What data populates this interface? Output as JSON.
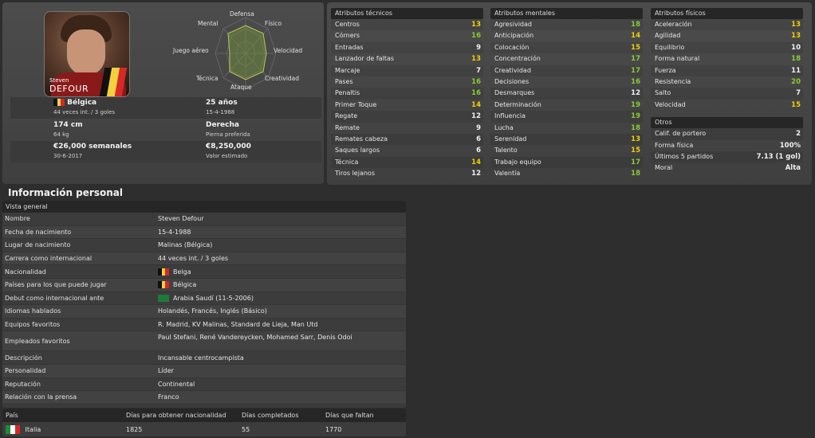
{
  "player": {
    "first_name": "Steven",
    "last_name": "DEFOUR",
    "nation": "Bélgica",
    "caps": "44 veces int. / 3 goles",
    "age": "25 años",
    "dob": "15-4-1988",
    "height": "174 cm",
    "weight": "64 kg",
    "foot": "Derecha",
    "foot_label": "Pierna preferida",
    "wage": "€26,000 semanales",
    "contract_end": "30-6-2017",
    "value": "€8,250,000",
    "value_label": "Valor estimado"
  },
  "radar": {
    "labels": [
      "Defensa",
      "Físico",
      "Velocidad",
      "Creatividad",
      "Ataque",
      "Técnica",
      "Juego aéreo",
      "Mental"
    ]
  },
  "technical": {
    "title": "Atributos técnicos",
    "items": [
      {
        "name": "Centros",
        "value": "13"
      },
      {
        "name": "Córners",
        "value": "16"
      },
      {
        "name": "Entradas",
        "value": "9"
      },
      {
        "name": "Lanzador de faltas",
        "value": "13"
      },
      {
        "name": "Marcaje",
        "value": "7"
      },
      {
        "name": "Pases",
        "value": "16"
      },
      {
        "name": "Penaltis",
        "value": "16"
      },
      {
        "name": "Primer Toque",
        "value": "14"
      },
      {
        "name": "Regate",
        "value": "12"
      },
      {
        "name": "Remate",
        "value": "9"
      },
      {
        "name": "Remates cabeza",
        "value": "6"
      },
      {
        "name": "Saques largos",
        "value": "6"
      },
      {
        "name": "Técnica",
        "value": "14"
      },
      {
        "name": "Tiros lejanos",
        "value": "12"
      }
    ]
  },
  "mental": {
    "title": "Atributos mentales",
    "items": [
      {
        "name": "Agresividad",
        "value": "18"
      },
      {
        "name": "Anticipación",
        "value": "14"
      },
      {
        "name": "Colocación",
        "value": "15"
      },
      {
        "name": "Concentración",
        "value": "17"
      },
      {
        "name": "Creatividad",
        "value": "17"
      },
      {
        "name": "Decisiones",
        "value": "16"
      },
      {
        "name": "Desmarques",
        "value": "12"
      },
      {
        "name": "Determinación",
        "value": "19"
      },
      {
        "name": "Influencia",
        "value": "19"
      },
      {
        "name": "Lucha",
        "value": "18"
      },
      {
        "name": "Serenidad",
        "value": "13"
      },
      {
        "name": "Talento",
        "value": "15"
      },
      {
        "name": "Trabajo equipo",
        "value": "17"
      },
      {
        "name": "Valentía",
        "value": "18"
      }
    ]
  },
  "physical": {
    "title": "Atributos físicos",
    "items": [
      {
        "name": "Aceleración",
        "value": "13"
      },
      {
        "name": "Agilidad",
        "value": "13"
      },
      {
        "name": "Equilibrio",
        "value": "10"
      },
      {
        "name": "Forma natural",
        "value": "18"
      },
      {
        "name": "Fuerza",
        "value": "11"
      },
      {
        "name": "Resistencia",
        "value": "20"
      },
      {
        "name": "Salto",
        "value": "7"
      },
      {
        "name": "Velocidad",
        "value": "15"
      }
    ]
  },
  "others": {
    "title": "Otros",
    "items": [
      {
        "name": "Calif. de portero",
        "value": "2"
      },
      {
        "name": "Forma física",
        "value": "100%"
      },
      {
        "name": "Últimos 5 partidos",
        "value": "7.13 (1 gol)"
      },
      {
        "name": "Moral",
        "value": "Alta"
      }
    ]
  },
  "personal": {
    "title": "Información personal",
    "subtitle": "Vista general",
    "rows": [
      {
        "key": "Nombre",
        "value": "Steven Defour"
      },
      {
        "key": "Fecha de nacimiento",
        "value": "15-4-1988"
      },
      {
        "key": "Lugar de nacimiento",
        "value": "Malinas (Bélgica)"
      },
      {
        "key": "Carrera como internacional",
        "value": "44 veces int. / 3 goles"
      },
      {
        "key": "Nacionalidad",
        "value": "Belga"
      },
      {
        "key": "Países para los que puede jugar",
        "value": "Bélgica"
      },
      {
        "key": "Debut como internacional ante",
        "value": "Arabia Saudí (11-5-2006)"
      },
      {
        "key": "Idiomas hablados",
        "value": "Holandés, Francés, Inglés (Básico)"
      },
      {
        "key": "Equipos favoritos",
        "value": "R. Madrid, KV Malinas, Standard de Lieja, Man Utd"
      },
      {
        "key": "Empleados favoritos",
        "value": "Paul Stefani, René Vandereycken, Mohamed Sarr, Denis Odoi"
      },
      {
        "key": "Descripción",
        "value": "Incansable centrocampista"
      },
      {
        "key": "Personalidad",
        "value": "Líder"
      },
      {
        "key": "Reputación",
        "value": "Continental"
      },
      {
        "key": "Relación con la prensa",
        "value": "Franco"
      }
    ]
  },
  "nationality_table": {
    "headers": [
      "País",
      "Días para obtener nacionalidad",
      "Días completados",
      "Días que faltan"
    ],
    "row": {
      "country": "Italia",
      "days_needed": "1825",
      "days_done": "55",
      "days_left": "1770"
    }
  },
  "colors": {
    "value_white": "#f0f0f0",
    "value_yellow": "#f0d000",
    "value_green": "#88cc33",
    "belgium": [
      "#111111",
      "#f4d03f",
      "#d62828"
    ],
    "italy": [
      "#1f8a3b",
      "#ffffff",
      "#d62828"
    ],
    "saudi": "#1f7a3a"
  }
}
